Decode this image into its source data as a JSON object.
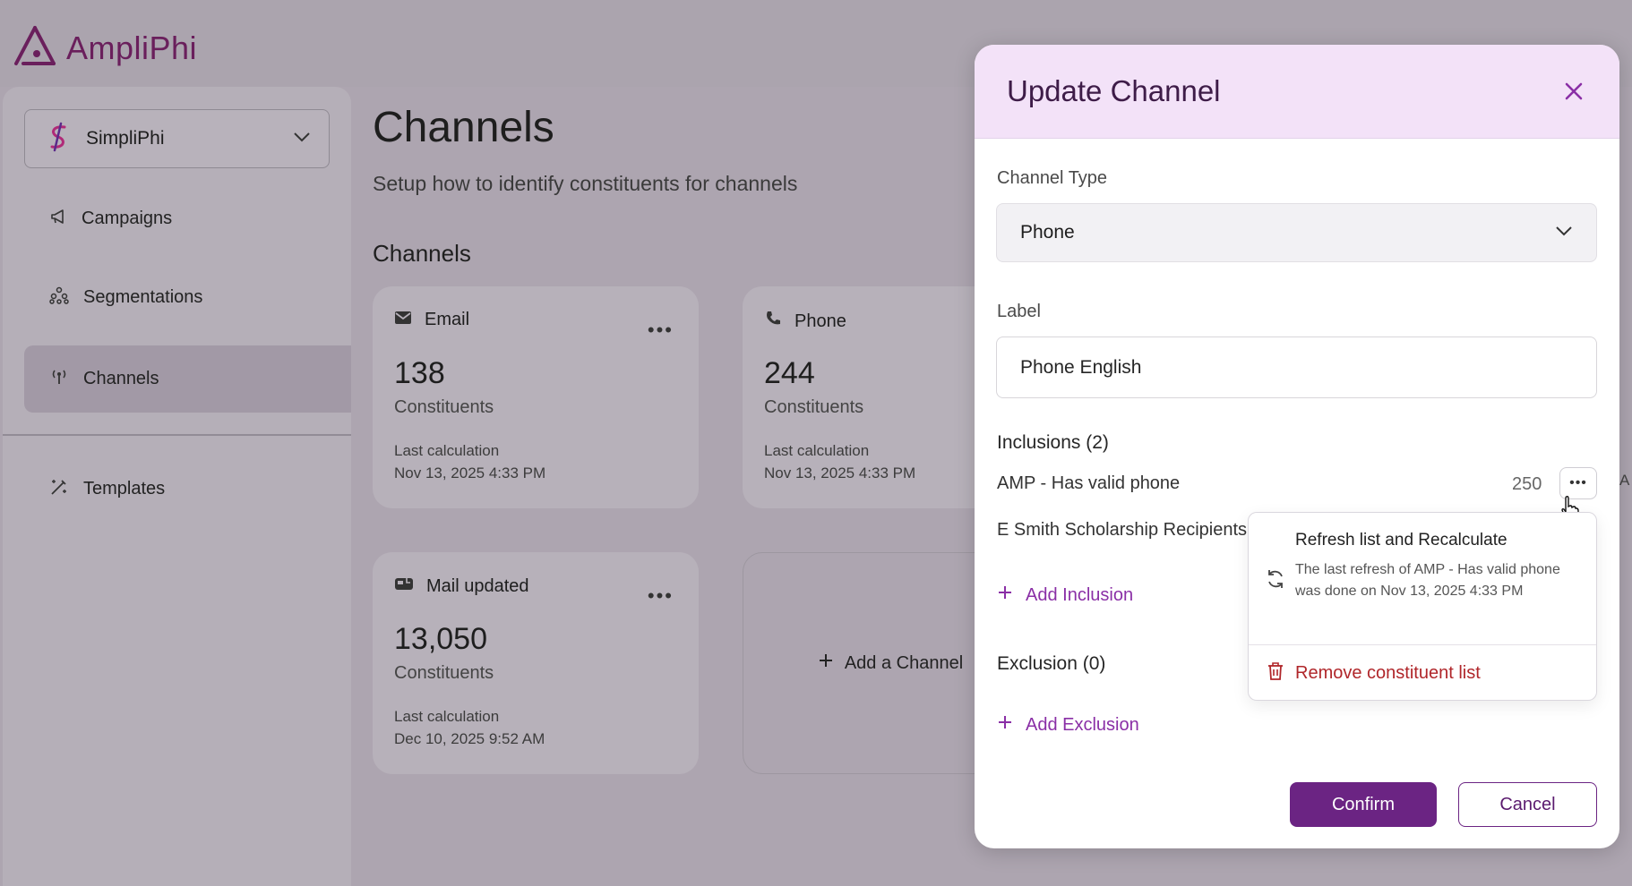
{
  "app": {
    "name": "AmpliPhi",
    "org": "SimpliPhi"
  },
  "sidebar": {
    "items": [
      {
        "label": "Campaigns",
        "icon": "megaphone-icon"
      },
      {
        "label": "Segmentations",
        "icon": "segment-icon"
      },
      {
        "label": "Channels",
        "icon": "antenna-icon",
        "active": true
      },
      {
        "label": "Templates",
        "icon": "magic-wand-icon"
      }
    ]
  },
  "main": {
    "title": "Channels",
    "subtitle": "Setup how to identify constituents for channels",
    "section_title": "Channels",
    "cards": [
      {
        "name": "Email",
        "icon": "email-icon",
        "count": "138",
        "unit": "Constituents",
        "last_label": "Last calculation",
        "last_date": "Nov 13, 2025 4:33 PM"
      },
      {
        "name": "Phone",
        "icon": "phone-icon",
        "count": "244",
        "unit": "Constituents",
        "last_label": "Last calculation",
        "last_date": "Nov 13, 2025 4:33 PM"
      },
      {
        "name": "Mail updated",
        "icon": "mailbox-icon",
        "count": "13,050",
        "unit": "Constituents",
        "last_label": "Last calculation",
        "last_date": "Dec 10, 2025 9:52 AM"
      }
    ],
    "add_card_label": "Add a Channel",
    "right_clip_text": "A"
  },
  "modal": {
    "title": "Update Channel",
    "channel_type_label": "Channel Type",
    "channel_type_value": "Phone",
    "label_label": "Label",
    "label_value": "Phone English",
    "inclusions_title": "Inclusions (2)",
    "inclusions": [
      {
        "name": "AMP - Has valid phone",
        "count": "250"
      },
      {
        "name": "E Smith Scholarship Recipients"
      }
    ],
    "add_inclusion": "Add Inclusion",
    "exclusion_title": "Exclusion (0)",
    "add_exclusion": "Add Exclusion",
    "menu": {
      "refresh_title": "Refresh list and Recalculate",
      "refresh_desc": "The last refresh of AMP - Has valid phone was done on Nov 13, 2025 4:33 PM",
      "remove_label": "Remove constituent list"
    },
    "confirm": "Confirm",
    "cancel": "Cancel"
  },
  "colors": {
    "accent": "#6b2483",
    "link": "#8a2fa6",
    "danger": "#b0262a",
    "header_bg": "#f3e2f8"
  }
}
